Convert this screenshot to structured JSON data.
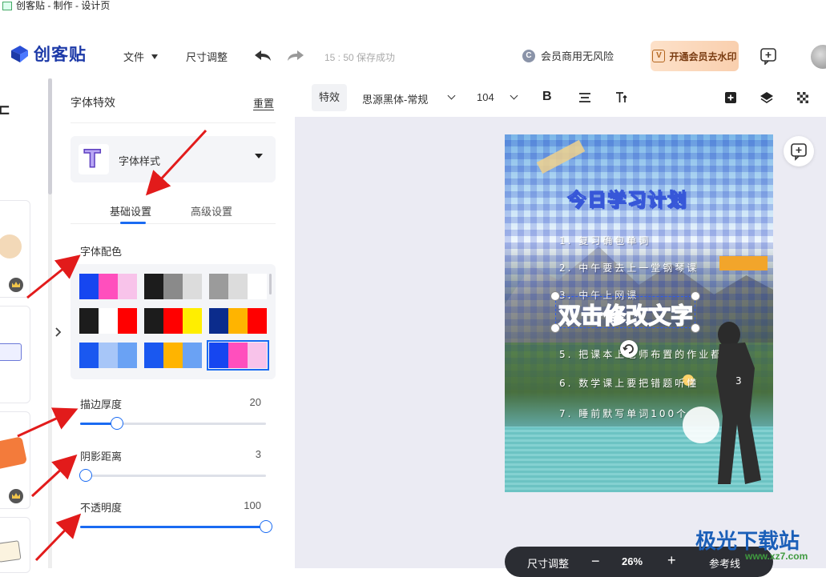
{
  "window": {
    "title": "创客贴 - 制作 - 设计页"
  },
  "header": {
    "logo_text": "创客贴",
    "menu_file": "文件",
    "menu_resize": "尺寸调整",
    "save_status": "15 : 50 保存成功",
    "commercial_badge": "C",
    "commercial_text": "会员商用无风险",
    "vip_badge": "V",
    "vip_button": "开通会员去水印"
  },
  "panel": {
    "title": "字体特效",
    "reset": "重置",
    "style_thumb": "T",
    "style_select": "字体样式",
    "tabs": [
      {
        "label": "基础设置",
        "active": true
      },
      {
        "label": "高级设置",
        "active": false
      }
    ],
    "color_label": "字体配色",
    "swatches": [
      [
        "#1646f0",
        "#ff4fbd",
        "#f8c3ea"
      ],
      [
        "#1c1c1c",
        "#8a8a8a",
        "#dcdcdc"
      ],
      [
        "#9b9b9b",
        "#dcdcdc",
        "#ffffff"
      ],
      [
        "#1c1c1c",
        "#ffffff",
        "#ff0000"
      ],
      [
        "#1c1c1c",
        "#ff0000",
        "#ffee00"
      ],
      [
        "#0b2c8c",
        "#ffb400",
        "#ff0000"
      ],
      [
        "#1a58f0",
        "#a7c6f8",
        "#6aa2f4"
      ],
      [
        "#1a58f0",
        "#ffb400",
        "#6aa2f4"
      ],
      [
        "#1646f0",
        "#ff4fbd",
        "#f8c3ea"
      ]
    ],
    "selected_swatch": 8,
    "sliders": [
      {
        "label": "描边厚度",
        "value": "20",
        "fraction": 0.2
      },
      {
        "label": "阴影距离",
        "value": "3",
        "fraction": 0.03
      },
      {
        "label": "不透明度",
        "value": "100",
        "fraction": 1.0
      }
    ]
  },
  "toolbar": {
    "effects": "特效",
    "font_family": "思源黑体-常规",
    "font_size": "104",
    "bold_glyph": "B"
  },
  "canvas": {
    "poster_title": "今日学习计划",
    "poster_lines": [
      "1.  复习确包单词",
      "2.  中午要去上一堂钢琴课",
      "3.  中午上网课",
      "5.  把课本上老师布置的作业都做完",
      "6.  数学课上要把错题听懂",
      "7.  睡前默写单词100个"
    ],
    "selected_text": "双击修改文字"
  },
  "zoom": {
    "resize": "尺寸调整",
    "minus": "−",
    "level": "26%",
    "plus": "+",
    "guides": "参考线"
  },
  "watermark": {
    "text": "极光下载站",
    "url": "www.xz7.com"
  },
  "colors": {
    "accent": "#1a6bf2",
    "logo": "#1d3aa8",
    "annotation": "#e21b1b"
  }
}
